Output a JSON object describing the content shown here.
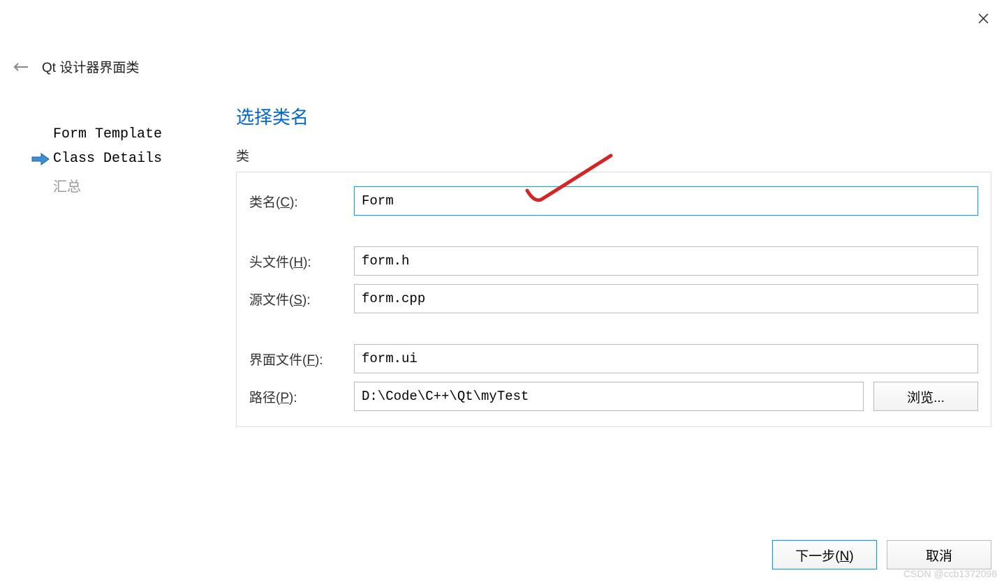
{
  "header": {
    "title": "Qt 设计器界面类"
  },
  "sidebar": {
    "items": [
      {
        "label": "Form Template",
        "state": "past"
      },
      {
        "label": "Class Details",
        "state": "active"
      },
      {
        "label": "汇总",
        "state": "future"
      }
    ]
  },
  "main": {
    "title": "选择类名",
    "section_label": "类",
    "fields": {
      "class_name": {
        "label_pre": "类名(",
        "label_key": "C",
        "label_post": "):",
        "value": "Form"
      },
      "header_file": {
        "label_pre": "头文件(",
        "label_key": "H",
        "label_post": "):",
        "value": "form.h"
      },
      "source_file": {
        "label_pre": "源文件(",
        "label_key": "S",
        "label_post": "):",
        "value": "form.cpp"
      },
      "ui_file": {
        "label_pre": "界面文件(",
        "label_key": "F",
        "label_post": "):",
        "value": "form.ui"
      },
      "path": {
        "label_pre": "路径(",
        "label_key": "P",
        "label_post": "):",
        "value": "D:\\Code\\C++\\Qt\\myTest"
      }
    },
    "browse_label": "浏览..."
  },
  "footer": {
    "next_pre": "下一步(",
    "next_key": "N",
    "next_post": ")",
    "cancel": "取消"
  },
  "watermark": "CSDN @ccb1372098"
}
